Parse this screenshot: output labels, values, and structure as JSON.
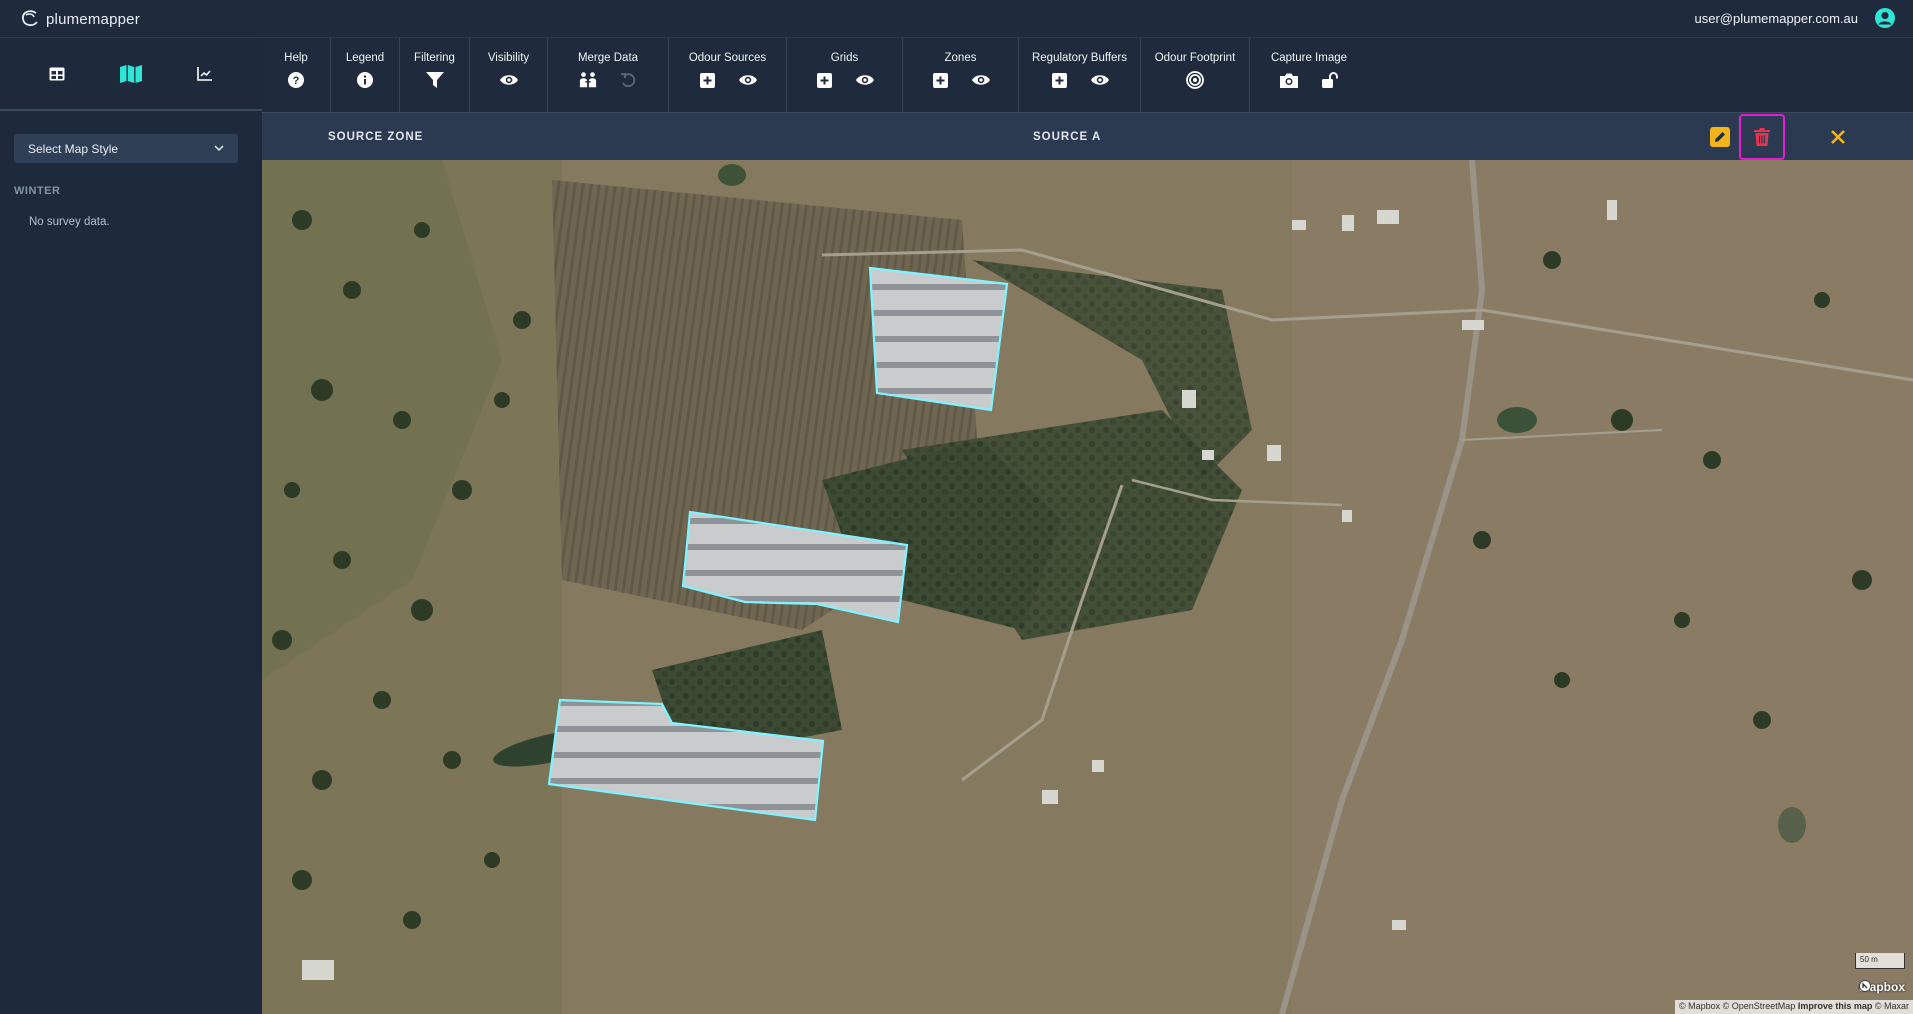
{
  "app": {
    "logo_text": "plumemapper",
    "user_email": "user@plumemapper.com.au"
  },
  "sidebar": {
    "map_style_select": "Select Map Style",
    "season_label": "WINTER",
    "no_data_text": "No survey data."
  },
  "toolbar": {
    "groups": [
      {
        "label": "Help"
      },
      {
        "label": "Legend"
      },
      {
        "label": "Filtering"
      },
      {
        "label": "Visibility"
      },
      {
        "label": "Merge Data"
      },
      {
        "label": "Odour Sources"
      },
      {
        "label": "Grids"
      },
      {
        "label": "Zones"
      },
      {
        "label": "Regulatory Buffers"
      },
      {
        "label": "Odour Footprint"
      },
      {
        "label": "Capture Image"
      }
    ]
  },
  "zone_header": {
    "title": "SOURCE ZONE",
    "source_name": "SOURCE A"
  },
  "map": {
    "scale_label": "50 m",
    "mapbox_logo": "mapbox",
    "attribution_prefix": "© Mapbox © OpenStreetMap",
    "attribution_improve": "Improve this map",
    "attribution_suffix": "© Maxar"
  },
  "colors": {
    "accent": "#2ee6d6",
    "polygon_outline": "#7ff3ff",
    "edit": "#f3b41b",
    "delete": "#e8344e",
    "highlight": "#e81bd4",
    "close": "#f3b41b"
  }
}
